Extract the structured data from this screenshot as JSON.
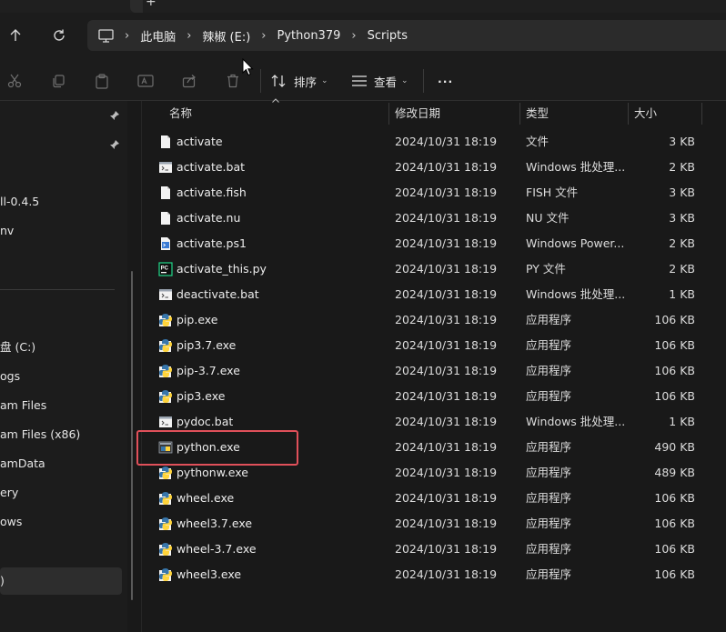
{
  "breadcrumb": {
    "items": [
      {
        "label": "此电脑"
      },
      {
        "label": "辣椒 (E:)"
      },
      {
        "label": "Python379"
      },
      {
        "label": "Scripts"
      }
    ]
  },
  "toolbar": {
    "sort_label": "排序",
    "view_label": "查看",
    "more_label": "···"
  },
  "sidebar": {
    "items": [
      {
        "label": "ll-0.4.5"
      },
      {
        "label": "nv"
      },
      {
        "label": "盘 (C:)"
      },
      {
        "label": "ogs"
      },
      {
        "label": "am Files"
      },
      {
        "label": "am Files (x86)"
      },
      {
        "label": "amData"
      },
      {
        "label": "ery"
      },
      {
        "label": "ows"
      },
      {
        "label": ")"
      }
    ]
  },
  "columns": {
    "name": "名称",
    "modified": "修改日期",
    "type": "类型",
    "size": "大小"
  },
  "files": [
    {
      "name": "activate",
      "modified": "2024/10/31 18:19",
      "type": "文件",
      "size": "3 KB",
      "icon": "file-icon"
    },
    {
      "name": "activate.bat",
      "modified": "2024/10/31 18:19",
      "type": "Windows 批处理...",
      "size": "2 KB",
      "icon": "batch-file-icon"
    },
    {
      "name": "activate.fish",
      "modified": "2024/10/31 18:19",
      "type": "FISH 文件",
      "size": "3 KB",
      "icon": "file-icon"
    },
    {
      "name": "activate.nu",
      "modified": "2024/10/31 18:19",
      "type": "NU 文件",
      "size": "3 KB",
      "icon": "file-icon"
    },
    {
      "name": "activate.ps1",
      "modified": "2024/10/31 18:19",
      "type": "Windows Power...",
      "size": "2 KB",
      "icon": "powershell-file-icon"
    },
    {
      "name": "activate_this.py",
      "modified": "2024/10/31 18:19",
      "type": "PY 文件",
      "size": "2 KB",
      "icon": "pycharm-file-icon"
    },
    {
      "name": "deactivate.bat",
      "modified": "2024/10/31 18:19",
      "type": "Windows 批处理...",
      "size": "1 KB",
      "icon": "batch-file-icon"
    },
    {
      "name": "pip.exe",
      "modified": "2024/10/31 18:19",
      "type": "应用程序",
      "size": "106 KB",
      "icon": "python-exe-icon"
    },
    {
      "name": "pip3.7.exe",
      "modified": "2024/10/31 18:19",
      "type": "应用程序",
      "size": "106 KB",
      "icon": "python-exe-icon"
    },
    {
      "name": "pip-3.7.exe",
      "modified": "2024/10/31 18:19",
      "type": "应用程序",
      "size": "106 KB",
      "icon": "python-exe-icon"
    },
    {
      "name": "pip3.exe",
      "modified": "2024/10/31 18:19",
      "type": "应用程序",
      "size": "106 KB",
      "icon": "python-exe-icon"
    },
    {
      "name": "pydoc.bat",
      "modified": "2024/10/31 18:19",
      "type": "Windows 批处理...",
      "size": "1 KB",
      "icon": "batch-file-icon"
    },
    {
      "name": "python.exe",
      "modified": "2024/10/31 18:19",
      "type": "应用程序",
      "size": "490 KB",
      "icon": "python-console-icon"
    },
    {
      "name": "pythonw.exe",
      "modified": "2024/10/31 18:19",
      "type": "应用程序",
      "size": "489 KB",
      "icon": "python-exe-icon"
    },
    {
      "name": "wheel.exe",
      "modified": "2024/10/31 18:19",
      "type": "应用程序",
      "size": "106 KB",
      "icon": "python-exe-icon"
    },
    {
      "name": "wheel3.7.exe",
      "modified": "2024/10/31 18:19",
      "type": "应用程序",
      "size": "106 KB",
      "icon": "python-exe-icon"
    },
    {
      "name": "wheel-3.7.exe",
      "modified": "2024/10/31 18:19",
      "type": "应用程序",
      "size": "106 KB",
      "icon": "python-exe-icon"
    },
    {
      "name": "wheel3.exe",
      "modified": "2024/10/31 18:19",
      "type": "应用程序",
      "size": "106 KB",
      "icon": "python-exe-icon"
    }
  ],
  "colors": {
    "background": "#191919",
    "address_bar": "#2b2b2b",
    "highlight_box": "#e0505a"
  }
}
